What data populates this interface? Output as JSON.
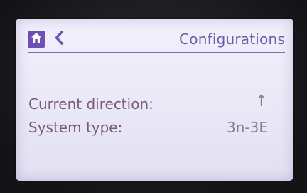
{
  "header": {
    "title": "Configurations"
  },
  "icons": {
    "home": "home-icon",
    "back": "chevron-left-icon"
  },
  "rows": [
    {
      "label": "Current direction:",
      "value": "↑"
    },
    {
      "label": "System type:",
      "value": "3n-3E"
    }
  ],
  "colors": {
    "accent": "#6d4fb5",
    "title": "#6b5fa6",
    "label": "#7a5a7e",
    "screen_bg": "#eeedf9"
  }
}
